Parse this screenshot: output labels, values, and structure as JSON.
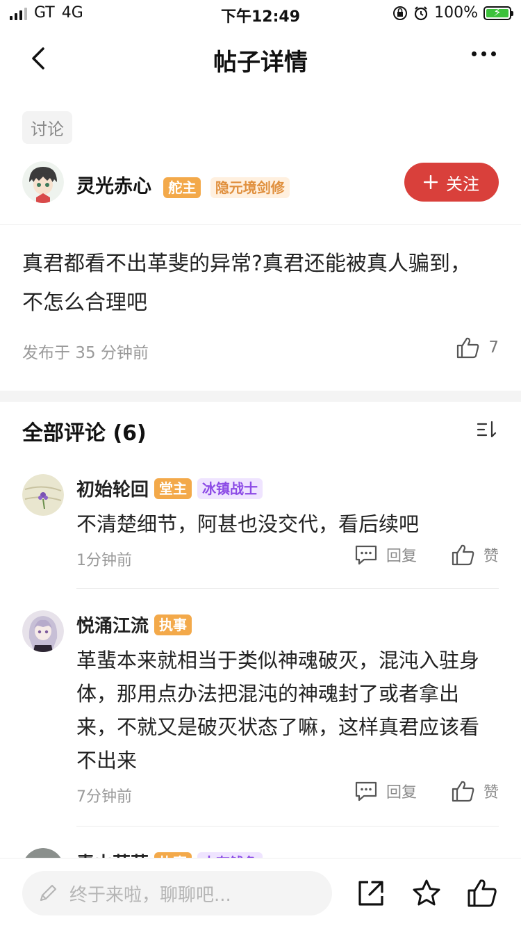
{
  "status_bar": {
    "carrier": "GT",
    "network": "4G",
    "time": "下午12:49",
    "battery": "100%"
  },
  "nav": {
    "title": "帖子详情"
  },
  "post": {
    "category": "讨论",
    "author": {
      "name": "灵光赤心",
      "badges": [
        "舵主",
        "隐元境剑修"
      ]
    },
    "follow_label": "关注",
    "body": "真君都看不出革斐的异常?真君还能被真人骗到，不怎么合理吧",
    "published": "发布于 35 分钟前",
    "likes": "7"
  },
  "comments_section": {
    "title": "全部评论 (6)",
    "items": [
      {
        "name": "初始轮回",
        "badges": [
          "堂主",
          "冰镇战士"
        ],
        "text": "不清楚细节，阿甚也没交代，看后续吧",
        "time": "1分钟前",
        "reply_label": "回复",
        "like_label": "赞"
      },
      {
        "name": "悦涌江流",
        "badges": [
          "执事"
        ],
        "text": "革蜚本来就相当于类似神魂破灭，混沌入驻身体，那用点办法把混沌的神魂封了或者拿出来，不就又是破灭状态了嘛，这样真君应该看不出来",
        "time": "7分钟前",
        "reply_label": "回复",
        "like_label": "赞"
      },
      {
        "name": "青山莫莫",
        "badges": [
          "执事",
          "大有钱色"
        ]
      }
    ]
  },
  "bottom_bar": {
    "input_placeholder": "终于来啦，聊聊吧..."
  },
  "colors": {
    "follow": "#d9403b",
    "badge_orange": "#f3a94a",
    "badge_purple_text": "#8c4be6",
    "battery_green": "#3cc13b"
  }
}
